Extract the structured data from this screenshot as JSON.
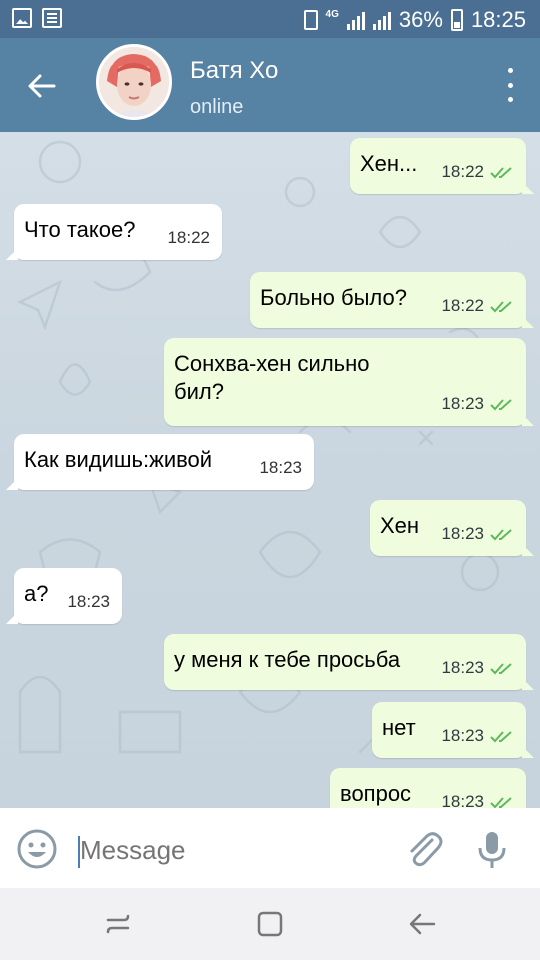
{
  "status_bar": {
    "network": "4G",
    "battery": "36%",
    "time": "18:25"
  },
  "header": {
    "title": "Батя Хо",
    "status": "online"
  },
  "messages": [
    {
      "dir": "out",
      "text": "Хен...",
      "time": "18:22"
    },
    {
      "dir": "in",
      "text": "Что такое?",
      "time": "18:22"
    },
    {
      "dir": "out",
      "text": "Больно было?",
      "time": "18:22"
    },
    {
      "dir": "out",
      "text": "Сонхва-хен сильно бил?",
      "time": "18:23"
    },
    {
      "dir": "in",
      "text": "Как видишь:живой",
      "time": "18:23"
    },
    {
      "dir": "out",
      "text": "Хен",
      "time": "18:23"
    },
    {
      "dir": "in",
      "text": "а?",
      "time": "18:23"
    },
    {
      "dir": "out",
      "text": "у меня к тебе просьба",
      "time": "18:23"
    },
    {
      "dir": "out",
      "text": "нет",
      "time": "18:23"
    },
    {
      "dir": "out",
      "text": "вопрос",
      "time": "18:23"
    }
  ],
  "composer": {
    "placeholder": "Message"
  },
  "colors": {
    "header": "#5682a3",
    "status_bar": "#4a6f93",
    "outgoing_bubble": "#effdde",
    "incoming_bubble": "#ffffff",
    "read_ticks": "#5cba5b",
    "chat_background": "#cfd9e1"
  },
  "icons": {
    "back": "arrow-left-icon",
    "menu": "more-vertical-icon",
    "emoji": "smiley-icon",
    "attach": "paperclip-icon",
    "mic": "microphone-icon",
    "read": "double-check-icon"
  }
}
